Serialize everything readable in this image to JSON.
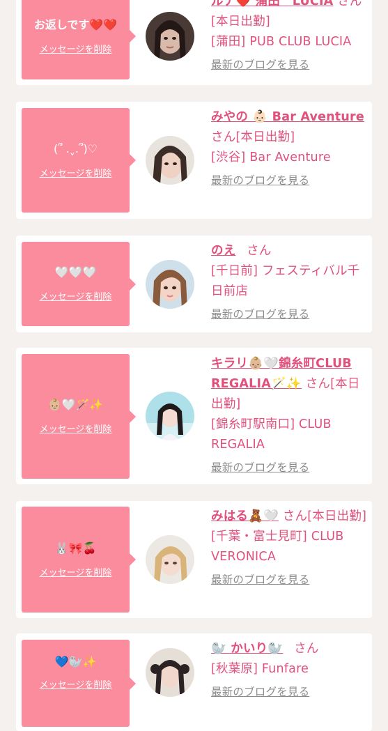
{
  "cards": [
    {
      "message": "お返しです❤️❤️",
      "delete_label": "メッセージを削除",
      "name": "ルナ❤️ 蒲田　LUCIA",
      "suffix": "さん[本日出勤]",
      "shop": "[蒲田] PUB CLUB LUCIA",
      "blog_label": "最新のブログを見る",
      "avatar_icon": "profile-photo-dark-hair"
    },
    {
      "message": "(՞ .ˬ.՞)♡",
      "delete_label": "メッセージを削除",
      "name": "みやの 👶🏻 Bar Aventure",
      "suffix": "さん[本日出勤]",
      "shop": "[渋谷] Bar Aventure",
      "blog_label": "最新のブログを見る",
      "avatar_icon": "profile-photo-dark-hair"
    },
    {
      "message": "🤍🤍🤍",
      "delete_label": "メッセージを削除",
      "name": "のえ",
      "suffix": "さん",
      "shop": "[千日前] フェスティバル千日前店",
      "blog_label": "最新のブログを見る",
      "avatar_icon": "profile-photo-brown-hair"
    },
    {
      "message": "👶🏼🤍🪄✨",
      "delete_label": "メッセージを削除",
      "name": "キラリ👶🏼🤍錦糸町CLUB REGALIA🪄✨",
      "suffix": "さん[本日出勤]",
      "shop": "[錦糸町駅南口] CLUB REGALIA",
      "blog_label": "最新のブログを見る",
      "avatar_icon": "profile-photo-light-blue"
    },
    {
      "message": "🐰🎀🍒",
      "delete_label": "メッセージを削除",
      "name": "みはる🧸🤍",
      "suffix": "さん[本日出勤]",
      "shop": "[千葉・富士見町] CLUB VERONICA",
      "blog_label": "最新のブログを見る",
      "avatar_icon": "profile-photo-blonde-hair"
    },
    {
      "message": "💙🦭✨",
      "delete_label": "メッセージを削除",
      "name": "🦭 かいり🦭",
      "suffix": "さん",
      "shop": "[秋葉原] Funfare",
      "blog_label": "最新のブログを見る",
      "avatar_icon": "profile-photo-twin-tails"
    }
  ],
  "colors": {
    "bubble": "#fb8c9e",
    "name": "#e0517c",
    "blog_link": "#8c8c8c",
    "page_bg": "#f5f1ee",
    "card_bg": "#ffffff"
  }
}
